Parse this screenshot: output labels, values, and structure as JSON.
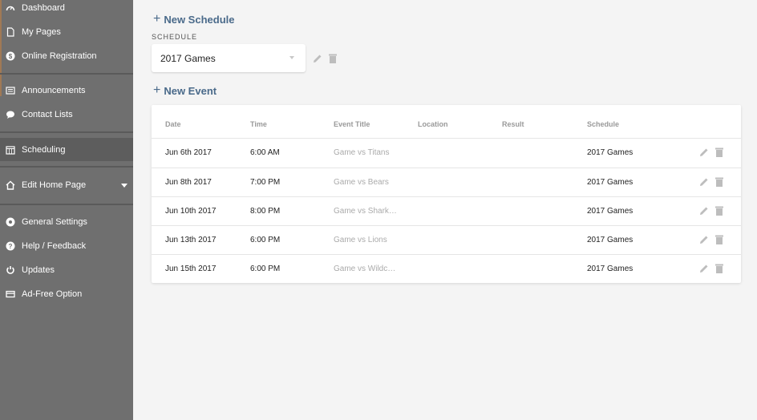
{
  "sidebar": {
    "items": [
      {
        "label": "Dashboard",
        "icon": "gauge-icon"
      },
      {
        "label": "My Pages",
        "icon": "page-icon"
      },
      {
        "label": "Online Registration",
        "icon": "dollar-icon"
      },
      {
        "label": "Announcements",
        "icon": "newspaper-icon"
      },
      {
        "label": "Contact Lists",
        "icon": "chat-bubble-icon"
      },
      {
        "label": "Scheduling",
        "icon": "calendar-icon"
      },
      {
        "label": "Edit Home Page",
        "icon": "home-icon"
      },
      {
        "label": "General Settings",
        "icon": "gear-icon"
      },
      {
        "label": "Help / Feedback",
        "icon": "help-icon"
      },
      {
        "label": "Updates",
        "icon": "refresh-icon"
      },
      {
        "label": "Ad-Free Option",
        "icon": "window-icon"
      }
    ],
    "active": "Scheduling"
  },
  "main": {
    "new_schedule_label": "New Schedule",
    "schedule_caption": "SCHEDULE",
    "schedule_selected": "2017 Games",
    "new_event_label": "New Event",
    "table": {
      "headers": {
        "date": "Date",
        "time": "Time",
        "title": "Event Title",
        "location": "Location",
        "result": "Result",
        "schedule": "Schedule"
      },
      "rows": [
        {
          "date": "Jun 6th 2017",
          "time": "6:00 AM",
          "title": "Game vs Titans",
          "location": "",
          "result": "",
          "schedule": "2017 Games"
        },
        {
          "date": "Jun 8th 2017",
          "time": "7:00 PM",
          "title": "Game vs Bears",
          "location": "",
          "result": "",
          "schedule": "2017 Games"
        },
        {
          "date": "Jun 10th 2017",
          "time": "8:00 PM",
          "title": "Game vs Shark…",
          "location": "",
          "result": "",
          "schedule": "2017 Games"
        },
        {
          "date": "Jun 13th 2017",
          "time": "6:00 PM",
          "title": "Game vs Lions",
          "location": "",
          "result": "",
          "schedule": "2017 Games"
        },
        {
          "date": "Jun 15th 2017",
          "time": "6:00 PM",
          "title": "Game vs Wildc…",
          "location": "",
          "result": "",
          "schedule": "2017 Games"
        }
      ]
    }
  },
  "colors": {
    "sidebar_bg": "#6f6f6f",
    "sidebar_active": "#5d5d5d",
    "link": "#4a6a8a",
    "icon_gray": "#bdbdbd"
  }
}
